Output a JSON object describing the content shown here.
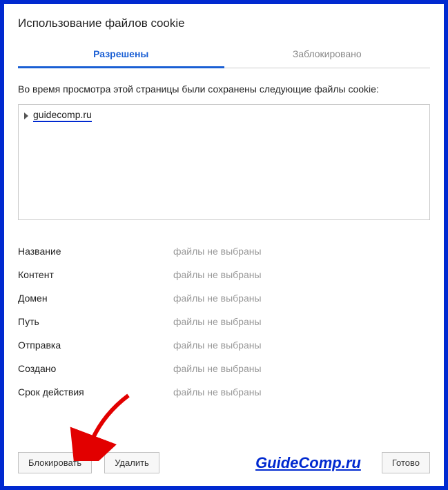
{
  "dialog": {
    "title": "Использование файлов cookie"
  },
  "tabs": {
    "allowed": "Разрешены",
    "blocked": "Заблокировано"
  },
  "description": "Во время просмотра этой страницы были сохранены следующие файлы cookie:",
  "tree": {
    "domain": "guidecomp.ru"
  },
  "details": [
    {
      "label": "Название",
      "value": "файлы не выбраны"
    },
    {
      "label": "Контент",
      "value": "файлы не выбраны"
    },
    {
      "label": "Домен",
      "value": "файлы не выбраны"
    },
    {
      "label": "Путь",
      "value": "файлы не выбраны"
    },
    {
      "label": "Отправка",
      "value": "файлы не выбраны"
    },
    {
      "label": "Создано",
      "value": "файлы не выбраны"
    },
    {
      "label": "Срок действия",
      "value": "файлы не выбраны"
    }
  ],
  "buttons": {
    "block": "Блокировать",
    "delete": "Удалить",
    "done": "Готово"
  },
  "watermark": "GuideComp.ru"
}
